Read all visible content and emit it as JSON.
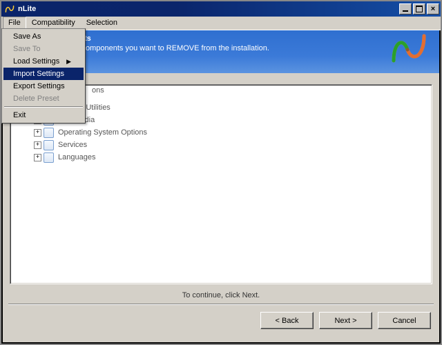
{
  "window": {
    "title": "nLite"
  },
  "menubar": {
    "file": "File",
    "compatibility": "Compatibility",
    "selection": "Selection"
  },
  "dropdown": {
    "save_as": "Save As",
    "save_to": "Save To",
    "load_settings": "Load Settings",
    "import_settings": "Import Settings",
    "export_settings": "Export Settings",
    "delete_preset": "Delete Preset",
    "exit": "Exit"
  },
  "banner": {
    "title_suffix": "ts",
    "subtitle_suffix": "omponents you want to REMOVE from the installation."
  },
  "tree": {
    "partial1": "ons",
    "item_internet_utilities": "Internet Utilities",
    "item_multimedia": "Multimedia",
    "item_os_options": "Operating System Options",
    "item_services": "Services",
    "item_languages": "Languages"
  },
  "footer": {
    "hint": "To continue, click Next."
  },
  "buttons": {
    "back": "< Back",
    "next": "Next >",
    "cancel": "Cancel"
  }
}
